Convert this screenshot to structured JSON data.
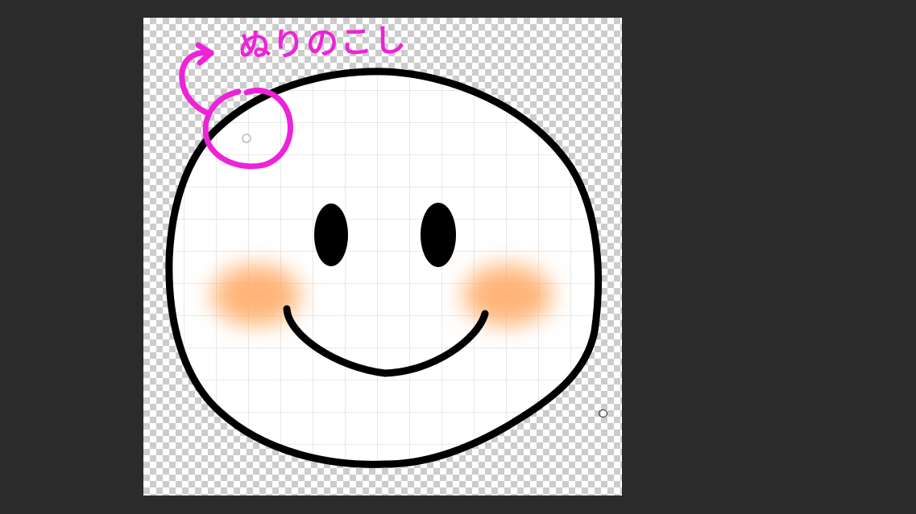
{
  "annotation": {
    "text": "ぬりのこし",
    "color": "#ee22d8"
  },
  "artwork": {
    "face_fill": "#ffffff",
    "outline_color": "#000000",
    "blush_color": "#ffb070"
  },
  "icons": {
    "cursor": "brush-cursor-icon",
    "arrow": "curved-arrow-icon",
    "highlight": "circle-marker-icon"
  }
}
